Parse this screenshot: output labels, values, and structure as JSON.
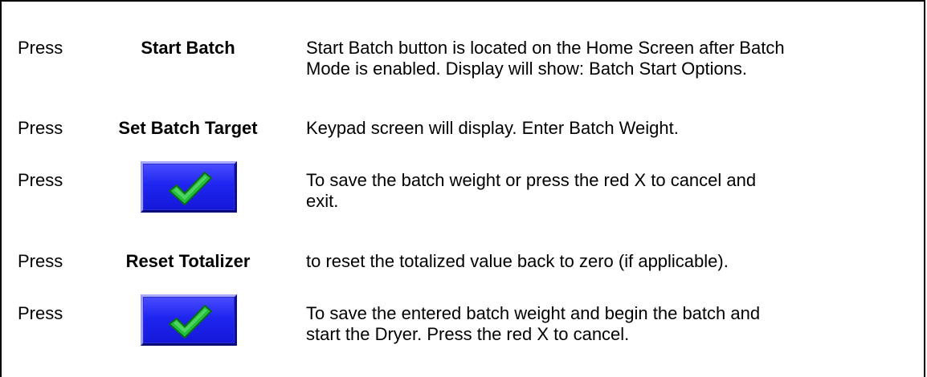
{
  "rows": [
    {
      "command": "Press",
      "key_label": "Start Batch",
      "description": "Start Batch button is located on the Home Screen after Batch\nMode is enabled.  Display will show: Batch Start Options."
    },
    {
      "command": "Press",
      "key_label": "Set Batch Target",
      "description": "Keypad screen will display.  Enter Batch Weight."
    },
    {
      "command": "Press",
      "key_icon": "checkmark-button-icon",
      "description": "To save the batch weight or press the red X to cancel and\nexit."
    },
    {
      "command": "Press",
      "key_label": "Reset Totalizer",
      "description": "to reset the totalized value back to zero (if applicable)."
    },
    {
      "command": "Press",
      "key_icon": "checkmark-button-icon",
      "description": "To save the entered batch weight and begin the batch and\nstart the Dryer.  Press the red X to cancel."
    }
  ],
  "colors": {
    "button_blue": "#1f25f0",
    "check_green": "#22c03a"
  }
}
